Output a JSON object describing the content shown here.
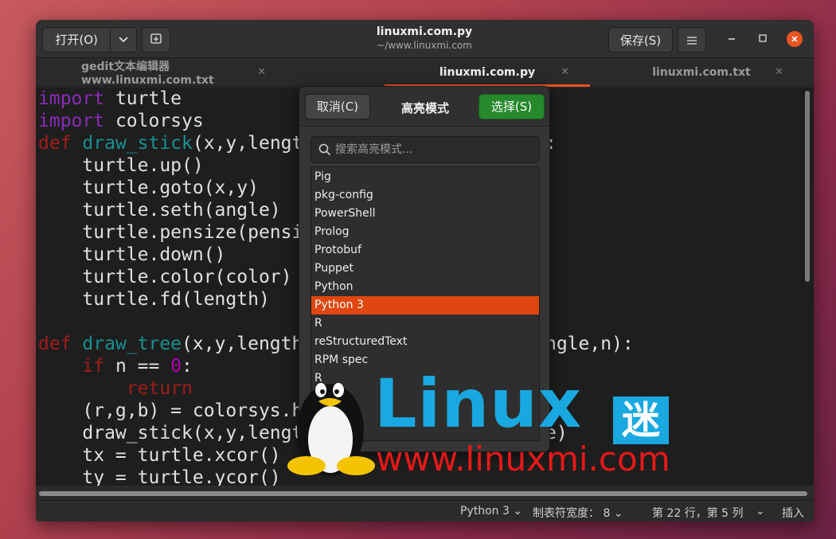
{
  "headerbar": {
    "open_label": "打开(O)",
    "title": "linuxmi.com.py",
    "subtitle": "~/www.linuxmi.com",
    "save_label": "保存(S)"
  },
  "tabs": [
    {
      "label": "gedit文本编辑器 www.linuxmi.com.txt"
    },
    {
      "label": "linuxmi.com.py"
    },
    {
      "label": "linuxmi.com.txt"
    }
  ],
  "popover": {
    "cancel_label": "取消(C)",
    "title": "高亮模式",
    "select_label": "选择(S)",
    "search_placeholder": "搜索高亮模式...",
    "items": [
      "Pig",
      "pkg-config",
      "PowerShell",
      "Prolog",
      "Protobuf",
      "Puppet",
      "Python",
      "Python 3",
      "R",
      "reStructuredText",
      "RPM spec",
      "R"
    ],
    "selected": "Python 3"
  },
  "statusbar": {
    "language": "Python 3",
    "tab_width": "制表符宽度： 8",
    "position": "第 22 行，第 5 列",
    "mode": "插入"
  },
  "watermark": {
    "brand": "Linux",
    "mi": "迷",
    "url": "www.linuxmi.com"
  },
  "colors": {
    "accent": "#e95420",
    "select_green": "#26892c",
    "watermark_blue": "#19a8e0",
    "watermark_red": "#e81818"
  }
}
